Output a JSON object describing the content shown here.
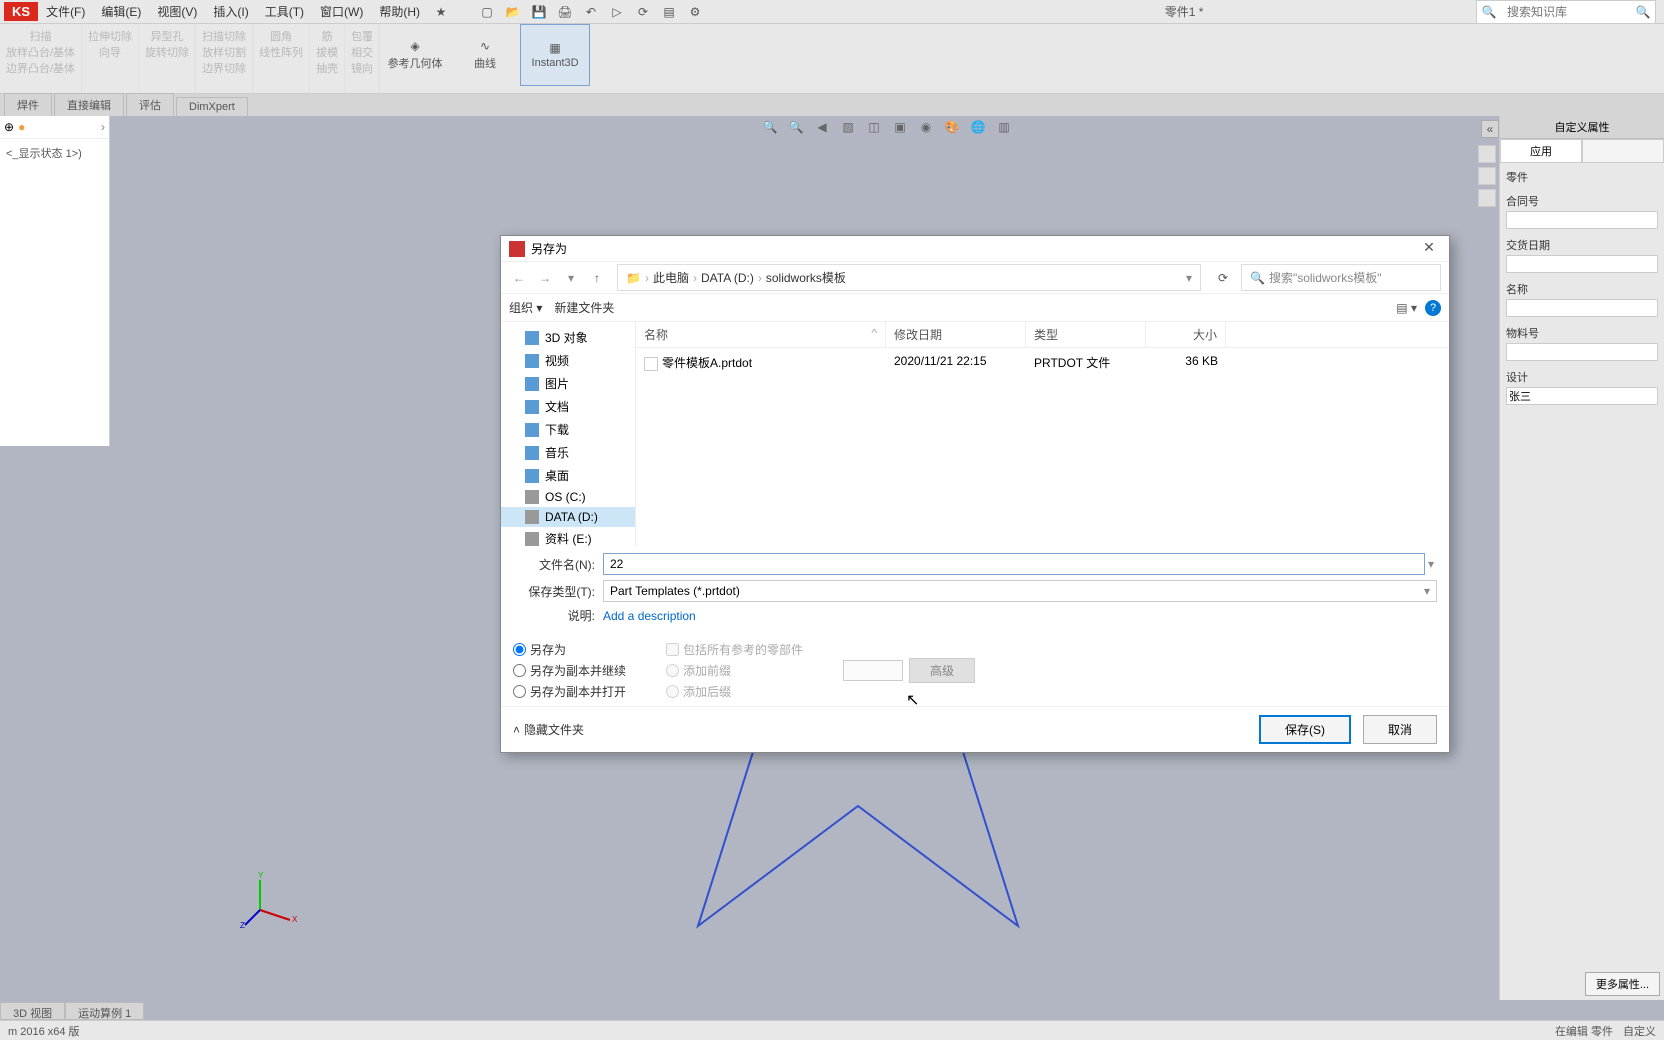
{
  "app": {
    "logo": "KS",
    "doc_title": "零件1 *"
  },
  "menu": {
    "file": "文件(F)",
    "edit": "编辑(E)",
    "view": "视图(V)",
    "insert": "插入(I)",
    "tools": "工具(T)",
    "window": "窗口(W)",
    "help": "帮助(H)"
  },
  "search": {
    "placeholder": "搜索知识库"
  },
  "ribbon": {
    "scan": "扫描",
    "boss": "放样凸台/基体",
    "bound": "边界凸台/基体",
    "extrude_cut": "拉伸切除",
    "rotate_cut": "旋转切除",
    "dir": "向导",
    "hole": "异型孔",
    "scan_cut": "扫描切除",
    "loft_cut": "放样切割",
    "bound_cut": "边界切除",
    "fillet": "圆角",
    "linear": "线性阵列",
    "rib": "筋",
    "draft": "拔模",
    "shell": "抽壳",
    "wrap": "包覆",
    "intersect": "相交",
    "mirror": "镜向",
    "ref_geo": "参考几何体",
    "curves": "曲线",
    "instant3d": "Instant3D"
  },
  "tabs": {
    "weld": "焊件",
    "direct": "直接编辑",
    "eval": "评估",
    "dimxpert": "DimXpert"
  },
  "left": {
    "state": "<_显示状态 1>)"
  },
  "right": {
    "title": "自定义属性",
    "apply": "应用",
    "part": "零件",
    "contract": "合同号",
    "delivery": "交货日期",
    "name": "名称",
    "material": "物料号",
    "design": "设计",
    "design_val": "张三",
    "more": "更多属性..."
  },
  "dialog": {
    "title": "另存为",
    "breadcrumb": {
      "pc": "此电脑",
      "drive": "DATA (D:)",
      "folder": "solidworks模板"
    },
    "search_placeholder": "搜索\"solidworks模板\"",
    "organize": "组织",
    "new_folder": "新建文件夹",
    "tree": {
      "3d": "3D 对象",
      "video": "视频",
      "pictures": "图片",
      "docs": "文档",
      "downloads": "下载",
      "music": "音乐",
      "desktop": "桌面",
      "osc": "OS (C:)",
      "datad": "DATA (D:)",
      "other": "资料 (E:)"
    },
    "columns": {
      "name": "名称",
      "date": "修改日期",
      "type": "类型",
      "size": "大小"
    },
    "file": {
      "name": "零件模板A.prtdot",
      "date": "2020/11/21 22:15",
      "type": "PRTDOT 文件",
      "size": "36 KB"
    },
    "filename_label": "文件名(N):",
    "filename_value": "22",
    "filetype_label": "保存类型(T):",
    "filetype_value": "Part Templates (*.prtdot)",
    "desc_label": "说明:",
    "desc_link": "Add a description",
    "opt_saveas": "另存为",
    "opt_copy_continue": "另存为副本并继续",
    "opt_copy_open": "另存为副本并打开",
    "opt_include_all": "包括所有参考的零部件",
    "opt_prefix": "添加前缀",
    "opt_suffix": "添加后缀",
    "advanced": "高级",
    "hide_folders": "隐藏文件夹",
    "save": "保存(S)",
    "cancel": "取消"
  },
  "bottom": {
    "view3d": "3D 视图",
    "motion": "运动算例 1",
    "version": "m 2016 x64 版"
  },
  "status": {
    "editing": "在编辑 零件",
    "custom": "自定义"
  }
}
